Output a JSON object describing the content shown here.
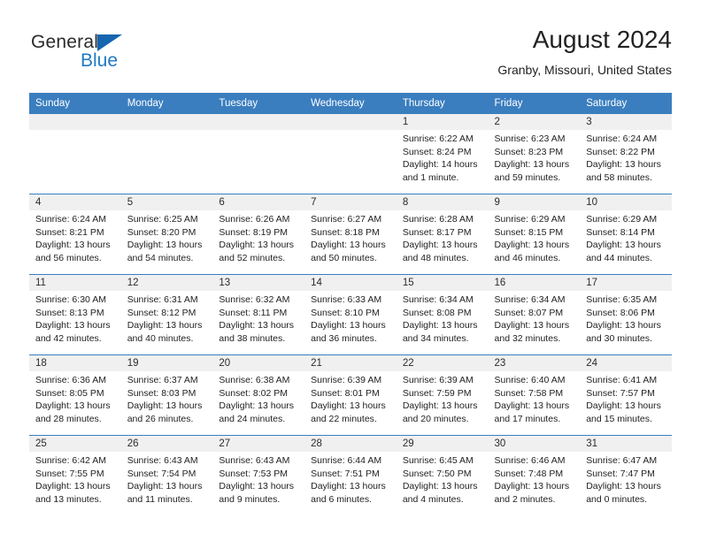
{
  "logo": {
    "word1": "General",
    "word2": "Blue",
    "triangle_color": "#1565b0",
    "blue_color": "#1f79c6"
  },
  "header": {
    "title": "August 2024",
    "subtitle": "Granby, Missouri, United States"
  },
  "theme": {
    "header_bg": "#3a7ebf",
    "daynum_bg": "#f0f0f0",
    "grid_line": "#3a7ebf"
  },
  "weekday_headers": [
    "Sunday",
    "Monday",
    "Tuesday",
    "Wednesday",
    "Thursday",
    "Friday",
    "Saturday"
  ],
  "weeks": [
    [
      {
        "day": "",
        "sunrise": "",
        "sunset": "",
        "daylight_line1": "",
        "daylight_line2": ""
      },
      {
        "day": "",
        "sunrise": "",
        "sunset": "",
        "daylight_line1": "",
        "daylight_line2": ""
      },
      {
        "day": "",
        "sunrise": "",
        "sunset": "",
        "daylight_line1": "",
        "daylight_line2": ""
      },
      {
        "day": "",
        "sunrise": "",
        "sunset": "",
        "daylight_line1": "",
        "daylight_line2": ""
      },
      {
        "day": "1",
        "sunrise": "Sunrise: 6:22 AM",
        "sunset": "Sunset: 8:24 PM",
        "daylight_line1": "Daylight: 14 hours",
        "daylight_line2": "and 1 minute."
      },
      {
        "day": "2",
        "sunrise": "Sunrise: 6:23 AM",
        "sunset": "Sunset: 8:23 PM",
        "daylight_line1": "Daylight: 13 hours",
        "daylight_line2": "and 59 minutes."
      },
      {
        "day": "3",
        "sunrise": "Sunrise: 6:24 AM",
        "sunset": "Sunset: 8:22 PM",
        "daylight_line1": "Daylight: 13 hours",
        "daylight_line2": "and 58 minutes."
      }
    ],
    [
      {
        "day": "4",
        "sunrise": "Sunrise: 6:24 AM",
        "sunset": "Sunset: 8:21 PM",
        "daylight_line1": "Daylight: 13 hours",
        "daylight_line2": "and 56 minutes."
      },
      {
        "day": "5",
        "sunrise": "Sunrise: 6:25 AM",
        "sunset": "Sunset: 8:20 PM",
        "daylight_line1": "Daylight: 13 hours",
        "daylight_line2": "and 54 minutes."
      },
      {
        "day": "6",
        "sunrise": "Sunrise: 6:26 AM",
        "sunset": "Sunset: 8:19 PM",
        "daylight_line1": "Daylight: 13 hours",
        "daylight_line2": "and 52 minutes."
      },
      {
        "day": "7",
        "sunrise": "Sunrise: 6:27 AM",
        "sunset": "Sunset: 8:18 PM",
        "daylight_line1": "Daylight: 13 hours",
        "daylight_line2": "and 50 minutes."
      },
      {
        "day": "8",
        "sunrise": "Sunrise: 6:28 AM",
        "sunset": "Sunset: 8:17 PM",
        "daylight_line1": "Daylight: 13 hours",
        "daylight_line2": "and 48 minutes."
      },
      {
        "day": "9",
        "sunrise": "Sunrise: 6:29 AM",
        "sunset": "Sunset: 8:15 PM",
        "daylight_line1": "Daylight: 13 hours",
        "daylight_line2": "and 46 minutes."
      },
      {
        "day": "10",
        "sunrise": "Sunrise: 6:29 AM",
        "sunset": "Sunset: 8:14 PM",
        "daylight_line1": "Daylight: 13 hours",
        "daylight_line2": "and 44 minutes."
      }
    ],
    [
      {
        "day": "11",
        "sunrise": "Sunrise: 6:30 AM",
        "sunset": "Sunset: 8:13 PM",
        "daylight_line1": "Daylight: 13 hours",
        "daylight_line2": "and 42 minutes."
      },
      {
        "day": "12",
        "sunrise": "Sunrise: 6:31 AM",
        "sunset": "Sunset: 8:12 PM",
        "daylight_line1": "Daylight: 13 hours",
        "daylight_line2": "and 40 minutes."
      },
      {
        "day": "13",
        "sunrise": "Sunrise: 6:32 AM",
        "sunset": "Sunset: 8:11 PM",
        "daylight_line1": "Daylight: 13 hours",
        "daylight_line2": "and 38 minutes."
      },
      {
        "day": "14",
        "sunrise": "Sunrise: 6:33 AM",
        "sunset": "Sunset: 8:10 PM",
        "daylight_line1": "Daylight: 13 hours",
        "daylight_line2": "and 36 minutes."
      },
      {
        "day": "15",
        "sunrise": "Sunrise: 6:34 AM",
        "sunset": "Sunset: 8:08 PM",
        "daylight_line1": "Daylight: 13 hours",
        "daylight_line2": "and 34 minutes."
      },
      {
        "day": "16",
        "sunrise": "Sunrise: 6:34 AM",
        "sunset": "Sunset: 8:07 PM",
        "daylight_line1": "Daylight: 13 hours",
        "daylight_line2": "and 32 minutes."
      },
      {
        "day": "17",
        "sunrise": "Sunrise: 6:35 AM",
        "sunset": "Sunset: 8:06 PM",
        "daylight_line1": "Daylight: 13 hours",
        "daylight_line2": "and 30 minutes."
      }
    ],
    [
      {
        "day": "18",
        "sunrise": "Sunrise: 6:36 AM",
        "sunset": "Sunset: 8:05 PM",
        "daylight_line1": "Daylight: 13 hours",
        "daylight_line2": "and 28 minutes."
      },
      {
        "day": "19",
        "sunrise": "Sunrise: 6:37 AM",
        "sunset": "Sunset: 8:03 PM",
        "daylight_line1": "Daylight: 13 hours",
        "daylight_line2": "and 26 minutes."
      },
      {
        "day": "20",
        "sunrise": "Sunrise: 6:38 AM",
        "sunset": "Sunset: 8:02 PM",
        "daylight_line1": "Daylight: 13 hours",
        "daylight_line2": "and 24 minutes."
      },
      {
        "day": "21",
        "sunrise": "Sunrise: 6:39 AM",
        "sunset": "Sunset: 8:01 PM",
        "daylight_line1": "Daylight: 13 hours",
        "daylight_line2": "and 22 minutes."
      },
      {
        "day": "22",
        "sunrise": "Sunrise: 6:39 AM",
        "sunset": "Sunset: 7:59 PM",
        "daylight_line1": "Daylight: 13 hours",
        "daylight_line2": "and 20 minutes."
      },
      {
        "day": "23",
        "sunrise": "Sunrise: 6:40 AM",
        "sunset": "Sunset: 7:58 PM",
        "daylight_line1": "Daylight: 13 hours",
        "daylight_line2": "and 17 minutes."
      },
      {
        "day": "24",
        "sunrise": "Sunrise: 6:41 AM",
        "sunset": "Sunset: 7:57 PM",
        "daylight_line1": "Daylight: 13 hours",
        "daylight_line2": "and 15 minutes."
      }
    ],
    [
      {
        "day": "25",
        "sunrise": "Sunrise: 6:42 AM",
        "sunset": "Sunset: 7:55 PM",
        "daylight_line1": "Daylight: 13 hours",
        "daylight_line2": "and 13 minutes."
      },
      {
        "day": "26",
        "sunrise": "Sunrise: 6:43 AM",
        "sunset": "Sunset: 7:54 PM",
        "daylight_line1": "Daylight: 13 hours",
        "daylight_line2": "and 11 minutes."
      },
      {
        "day": "27",
        "sunrise": "Sunrise: 6:43 AM",
        "sunset": "Sunset: 7:53 PM",
        "daylight_line1": "Daylight: 13 hours",
        "daylight_line2": "and 9 minutes."
      },
      {
        "day": "28",
        "sunrise": "Sunrise: 6:44 AM",
        "sunset": "Sunset: 7:51 PM",
        "daylight_line1": "Daylight: 13 hours",
        "daylight_line2": "and 6 minutes."
      },
      {
        "day": "29",
        "sunrise": "Sunrise: 6:45 AM",
        "sunset": "Sunset: 7:50 PM",
        "daylight_line1": "Daylight: 13 hours",
        "daylight_line2": "and 4 minutes."
      },
      {
        "day": "30",
        "sunrise": "Sunrise: 6:46 AM",
        "sunset": "Sunset: 7:48 PM",
        "daylight_line1": "Daylight: 13 hours",
        "daylight_line2": "and 2 minutes."
      },
      {
        "day": "31",
        "sunrise": "Sunrise: 6:47 AM",
        "sunset": "Sunset: 7:47 PM",
        "daylight_line1": "Daylight: 13 hours",
        "daylight_line2": "and 0 minutes."
      }
    ]
  ]
}
